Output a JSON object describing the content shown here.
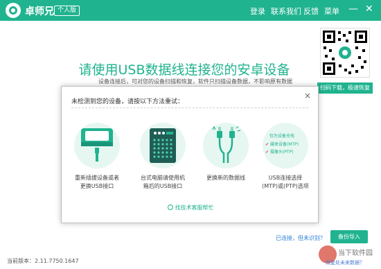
{
  "titlebar": {
    "app_name": "卓师兄",
    "edition": "个人版",
    "nav": [
      "登录",
      "联系我们",
      "反馈",
      "菜单"
    ],
    "minimize": "—",
    "close": "✕"
  },
  "main": {
    "heading": "请使用USB数据线连接您的安卓设备",
    "subtext": "设备连接后，可对您的设备扫描和恢复，软件只扫描设备数据，不影响原有数据"
  },
  "qr": {
    "banner": "扫码下载，极速恢复"
  },
  "dialog": {
    "title": "未检测到您的设备，请按以下方法重试：",
    "close": "×",
    "options": [
      {
        "label_line1": "重新插拔设备或者",
        "label_line2": "更换USB接口"
      },
      {
        "label_line1": "台式电脑请使用机",
        "label_line2": "箱后的USB接口"
      },
      {
        "label_line1": "更换新的数据线",
        "label_line2": ""
      },
      {
        "label_line1": "USB连接选择",
        "label_line2": "(MTP)或(PTP)选项"
      }
    ],
    "usb_modes": {
      "title": "仅为设备充电",
      "mtp": "媒体设备(MTP)",
      "ptp": "摄像头(PTP)"
    },
    "help_link": "找技术客服帮忙"
  },
  "footer": {
    "version": "当前版本：2.11.7750.1647",
    "connected_link": "已连接，但未识别？",
    "backup_button": "备份导入",
    "watermark_line1": "当下软件园",
    "watermark_line2": "恢复处未来数据？"
  },
  "colors": {
    "accent": "#20b38f",
    "light_accent": "#e6f7f1",
    "link_blue": "#2b7fd9",
    "check_red": "#e0453a"
  },
  "icons": [
    "logo-icon",
    "minimize-icon",
    "close-icon",
    "qr-code",
    "phone-usb-icon",
    "desktop-tower-icon",
    "usb-cables-icon",
    "check-icon",
    "headset-icon"
  ]
}
